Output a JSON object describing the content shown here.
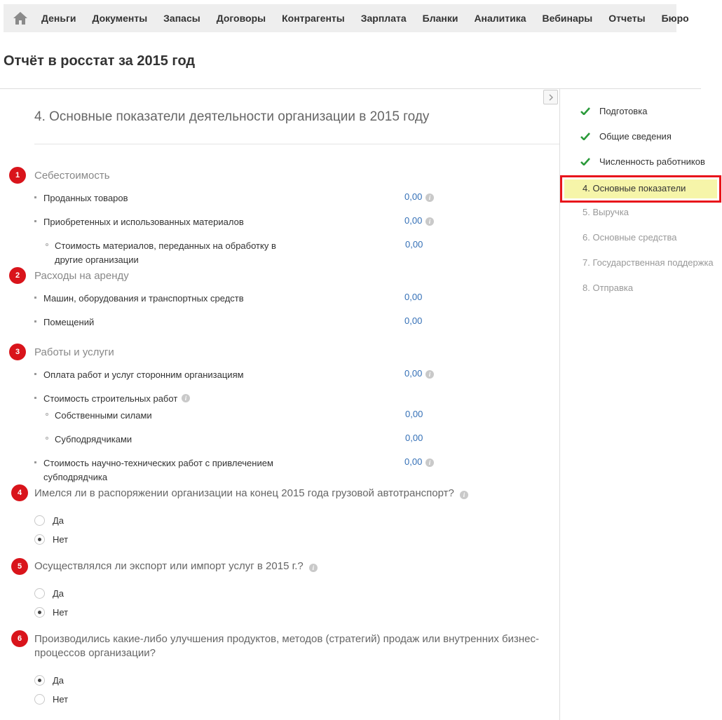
{
  "nav": {
    "home_icon": "home-icon",
    "items": [
      "Деньги",
      "Документы",
      "Запасы",
      "Договоры",
      "Контрагенты",
      "Зарплата",
      "Бланки",
      "Аналитика",
      "Вебинары",
      "Отчеты",
      "Бюро"
    ]
  },
  "page": {
    "title": "Отчёт в росстат за 2015 год"
  },
  "section": {
    "title": "4. Основные показатели деятельности организации в 2015 году"
  },
  "groups": [
    {
      "badge": "1",
      "title": "Себестоимость"
    },
    {
      "badge": "2",
      "title": "Расходы на аренду"
    },
    {
      "badge": "3",
      "title": "Работы и услуги"
    }
  ],
  "rows": [
    {
      "label": "Проданных товаров",
      "value": "0,00"
    },
    {
      "label": "Приобретенных и использованных материалов",
      "value": "0,00"
    },
    {
      "label": "Стоимость материалов, переданных на обработку в другие организации",
      "value": "0,00"
    },
    {
      "label": "Машин, оборудования и транспортных средств",
      "value": "0,00"
    },
    {
      "label": "Помещений",
      "value": "0,00"
    },
    {
      "label": "Оплата работ и услуг сторонним организациям",
      "value": "0,00"
    },
    {
      "label": "Стоимость строительных работ"
    },
    {
      "label": "Собственными силами",
      "value": "0,00"
    },
    {
      "label": "Субподрядчиками",
      "value": "0,00"
    },
    {
      "label": "Стоимость научно-технических работ с привлечением субподрядчика",
      "value": "0,00"
    }
  ],
  "questions": [
    {
      "badge": "4",
      "text": "Имелся ли в распоряжении организации на конец 2015 года грузовой автотранспорт?",
      "options": [
        "Да",
        "Нет"
      ],
      "selected": "Нет"
    },
    {
      "badge": "5",
      "text": "Осуществлялся ли экспорт или импорт услуг в 2015 г.?",
      "options": [
        "Да",
        "Нет"
      ],
      "selected": "Нет"
    },
    {
      "badge": "6",
      "text": "Производились какие-либо улучшения продуктов, методов (стратегий) продаж или внутренних бизнес-процессов организации?",
      "options": [
        "Да",
        "Нет"
      ],
      "selected": "Да"
    }
  ],
  "steps": [
    {
      "label": "Подготовка",
      "status": "done"
    },
    {
      "label": "Общие сведения",
      "status": "done"
    },
    {
      "label": "Численность работников",
      "status": "done"
    },
    {
      "label": "4.  Основные показатели",
      "status": "active"
    },
    {
      "label": "5.  Выручка",
      "status": "todo"
    },
    {
      "label": "6.  Основные средства",
      "status": "todo"
    },
    {
      "label": "7.  Государственная поддержка",
      "status": "todo"
    },
    {
      "label": "8.  Отправка",
      "status": "todo"
    }
  ],
  "colors": {
    "accent_red": "#d9141b",
    "value_blue": "#336fb6",
    "active_step_bg": "#f6f5a9",
    "check_green": "#2a9a3a"
  }
}
